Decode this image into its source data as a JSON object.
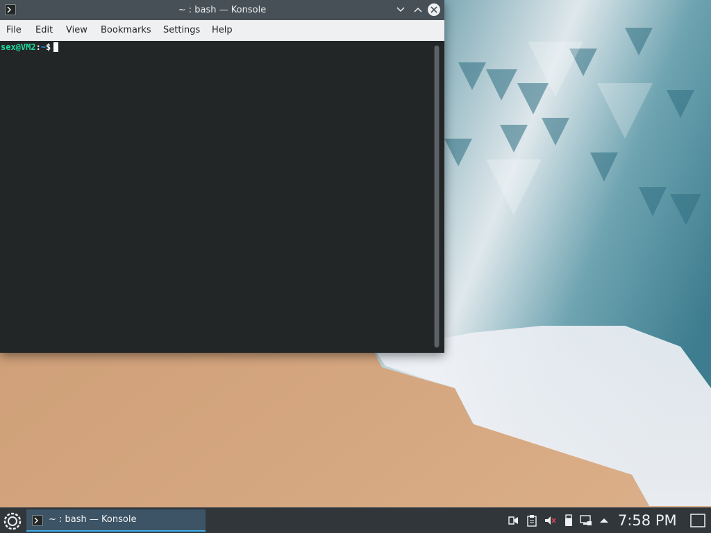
{
  "window": {
    "title": "~ : bash — Konsole",
    "menu": [
      "File",
      "Edit",
      "View",
      "Bookmarks",
      "Settings",
      "Help"
    ]
  },
  "terminal": {
    "user_host": "sex@VM2",
    "separator": ":",
    "path": "~",
    "prompt_symbol": "$"
  },
  "taskbar": {
    "task_label": "~ : bash — Konsole",
    "clock": "7:58 PM",
    "tray_icons": [
      "kdeconnect-icon",
      "clipboard-icon",
      "volume-muted-icon",
      "usb-drive-icon",
      "network-icon",
      "expand-tray-icon"
    ]
  },
  "colors": {
    "titlebar": "#475057",
    "terminal_bg": "#232627",
    "prompt_user": "#1cdc9a",
    "prompt_path": "#1d99f3",
    "panel_bg": "#31363b",
    "task_highlight": "#3daee9"
  }
}
